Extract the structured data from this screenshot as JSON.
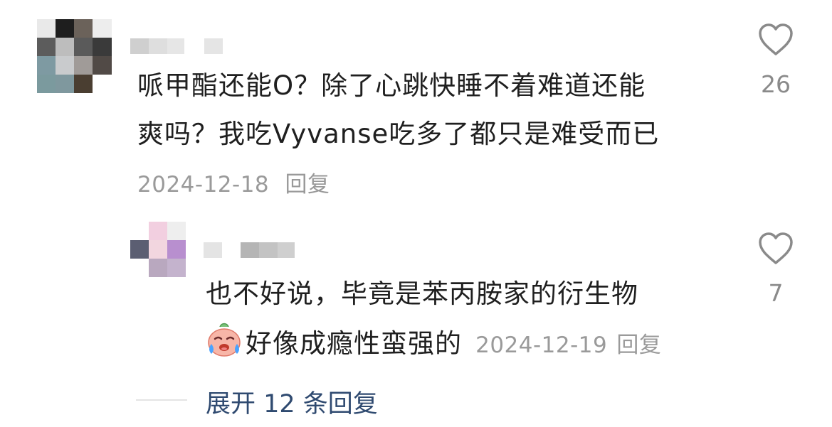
{
  "comment": {
    "text_line1": "哌甲酯还能O？除了心跳快睡不着难道还能",
    "text_line2": "爽吗？我吃Vyvanse吃多了都只是难受而已",
    "date": "2024-12-18",
    "reply_label": "回复",
    "likes": "26"
  },
  "reply": {
    "text_line1": "也不好说，毕竟是苯丙胺家的衍生物",
    "text_line2": "好像成瘾性蛮强的",
    "date": "2024-12-19",
    "reply_label": "回复",
    "likes": "7",
    "emoji": "crying-face-emoji"
  },
  "expand_replies": "展开 12 条回复",
  "colors": {
    "primary_text": "#1f1f1f",
    "meta_text": "#9a9a9a",
    "link_blue": "#2f4a70",
    "heart_stroke": "#8a8a8a"
  },
  "icons": [
    "heart-icon",
    "heart-icon"
  ]
}
